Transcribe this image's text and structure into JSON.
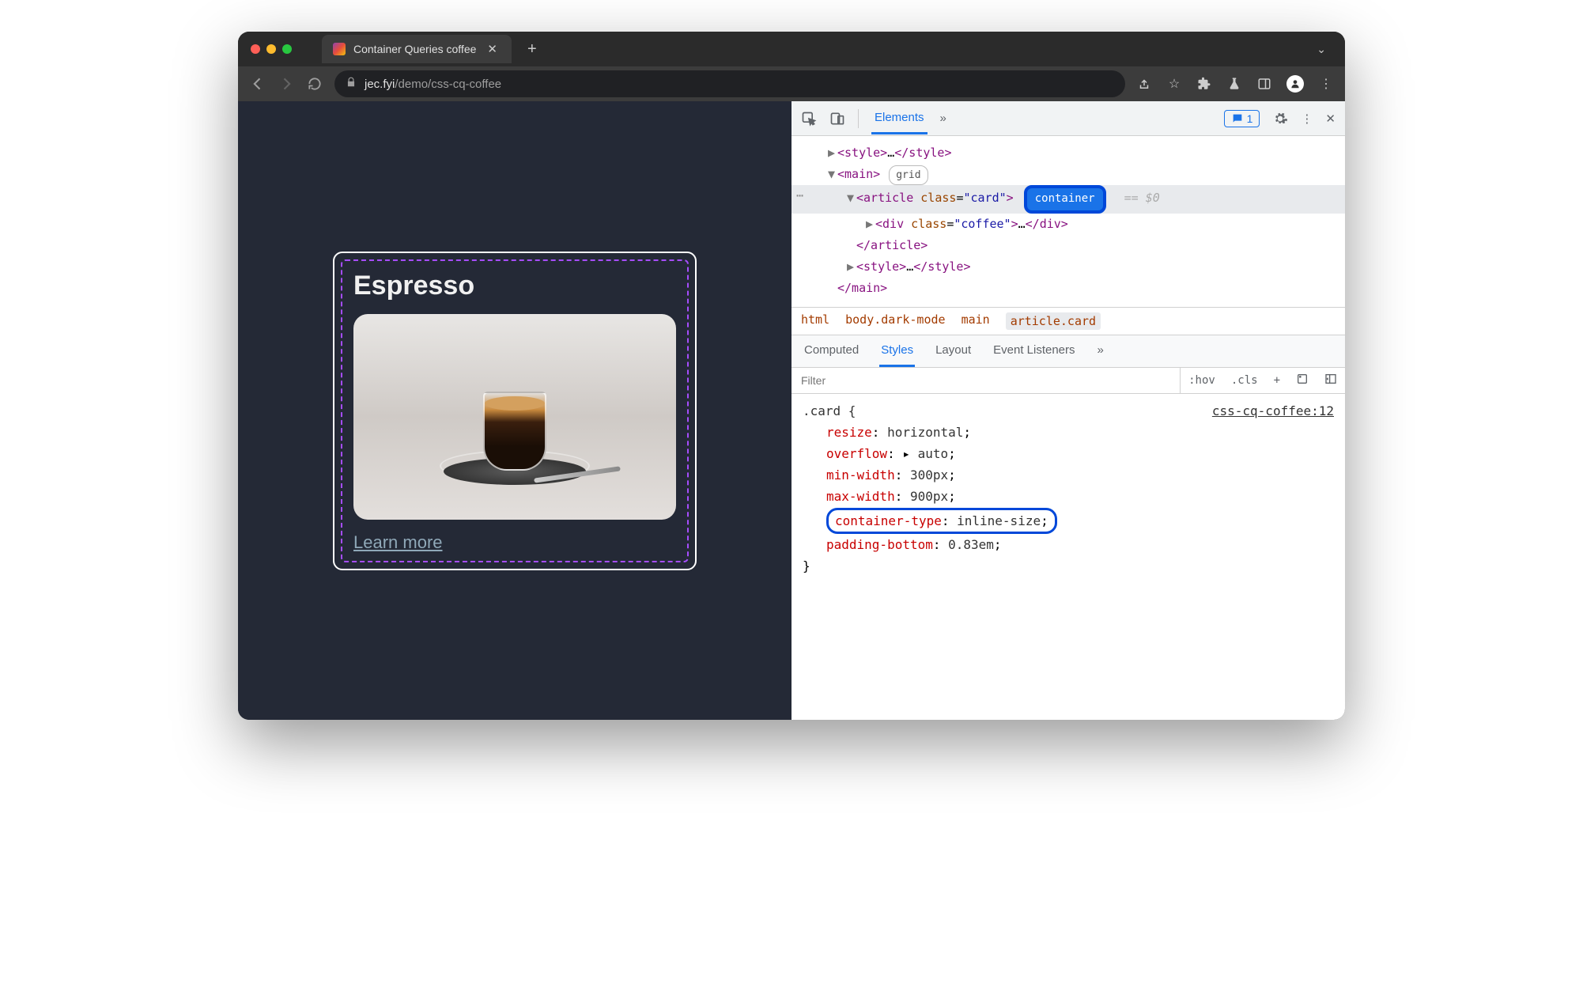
{
  "browser": {
    "tab_title": "Container Queries coffee",
    "url_host": "jec.fyi",
    "url_path": "/demo/css-cq-coffee"
  },
  "page": {
    "card_title": "Espresso",
    "learn_more": "Learn more"
  },
  "devtools": {
    "panel": "Elements",
    "issues_count": "1",
    "dom": {
      "style_open": "<style>",
      "style_dots": "…",
      "style_close": "</style>",
      "main_open": "<main>",
      "grid_badge": "grid",
      "article_open_1": "<article ",
      "article_class_attr": "class",
      "article_class_val": "\"card\"",
      "article_open_2": ">",
      "container_badge": "container",
      "eq0": "== $0",
      "div_open_1": "<div ",
      "div_class_val": "\"coffee\"",
      "div_open_2": ">",
      "div_dots": "…",
      "div_close": "</div>",
      "article_close": "</article>",
      "style2_open": "<style>",
      "style2_close": "</style>",
      "main_close": "</main>"
    },
    "breadcrumb": [
      "html",
      "body.dark-mode",
      "main",
      "article.card"
    ],
    "styles_tabs": [
      "Computed",
      "Styles",
      "Layout",
      "Event Listeners"
    ],
    "filter_placeholder": "Filter",
    "hov": ":hov",
    "cls": ".cls",
    "rule": {
      "selector": ".card {",
      "source": "css-cq-coffee:12",
      "d1_p": "resize",
      "d1_v": "horizontal",
      "d2_p": "overflow",
      "d2_v": "auto",
      "d3_p": "min-width",
      "d3_v": "300px",
      "d4_p": "max-width",
      "d4_v": "900px",
      "d5_p": "container-type",
      "d5_v": "inline-size",
      "d6_p": "padding-bottom",
      "d6_v": "0.83em",
      "close": "}"
    }
  }
}
